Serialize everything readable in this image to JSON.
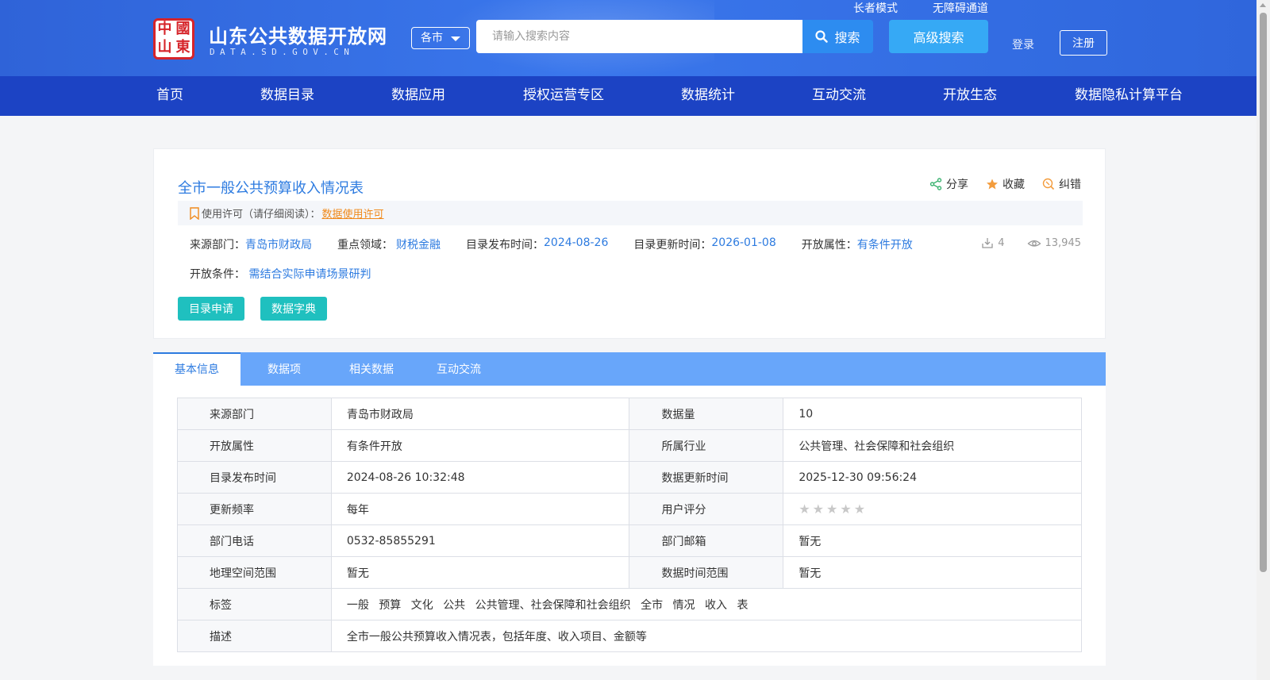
{
  "header": {
    "logo_seal": [
      "中",
      "國",
      "山",
      "東"
    ],
    "site_title": "山东公共数据开放网",
    "site_domain": "DATA.SD.GOV.CN",
    "region_label": "各市",
    "search_placeholder": "请输入搜索内容",
    "search_label": "搜索",
    "advanced_search_label": "高级搜索",
    "elder_mode_label": "长者模式",
    "accessibility_label": "无障碍通道",
    "login_label": "登录",
    "register_label": "注册"
  },
  "nav": {
    "items": [
      "首页",
      "数据目录",
      "数据应用",
      "授权运营专区",
      "数据统计",
      "互动交流",
      "开放生态",
      "数据隐私计算平台"
    ]
  },
  "dataset": {
    "title": "全市一般公共预算收入情况表",
    "actions": {
      "share": "分享",
      "favorite": "收藏",
      "report": "纠错"
    },
    "license_prefix": "使用许可（请仔细阅读）：",
    "license_link": "数据使用许可",
    "meta": {
      "source_label": "来源部门：",
      "source_value": "青岛市财政局",
      "domain_label": "重点领域：",
      "domain_value": "财税金融",
      "published_label": "目录发布时间：",
      "published_value": "2024-08-26",
      "updated_label": "目录更新时间：",
      "updated_value": "2026-01-08",
      "open_attr_label": "开放属性：",
      "open_attr_value": "有条件开放",
      "condition_label": "开放条件：",
      "condition_value": "需结合实际申请场景研判"
    },
    "downloads": "4",
    "views": "13,945",
    "apply_button": "目录申请",
    "dictionary_button": "数据字典"
  },
  "tabs": [
    "基本信息",
    "数据项",
    "相关数据",
    "互动交流"
  ],
  "info_table": {
    "rows": [
      {
        "l1": "来源部门",
        "v1": "青岛市财政局",
        "l2": "数据量",
        "v2": "10"
      },
      {
        "l1": "开放属性",
        "v1": "有条件开放",
        "l2": "所属行业",
        "v2": "公共管理、社会保障和社会组织"
      },
      {
        "l1": "目录发布时间",
        "v1": "2024-08-26 10:32:48",
        "l2": "数据更新时间",
        "v2": "2025-12-30 09:56:24"
      },
      {
        "l1": "更新频率",
        "v1": "每年",
        "l2": "用户评分",
        "v2": ""
      },
      {
        "l1": "部门电话",
        "v1": "0532-85855291",
        "l2": "部门邮箱",
        "v2": "暂无"
      },
      {
        "l1": "地理空间范围",
        "v1": "暂无",
        "l2": "数据时间范围",
        "v2": "暂无"
      }
    ],
    "tags_label": "标签",
    "tags": [
      "一般",
      "预算",
      "文化",
      "公共",
      "公共管理、社会保障和社会组织",
      "全市",
      "情况",
      "收入",
      "表"
    ],
    "desc_label": "描述",
    "desc_value": "全市一般公共预算收入情况表，包括年度、收入项目、金额等",
    "rating": 0,
    "rating_max": 5
  },
  "colors": {
    "header_blue": "#3a77ec",
    "nav_blue": "#1c43c4",
    "link_blue": "#2d7be0",
    "teal": "#1fc0bf",
    "orange": "#f08a1c"
  }
}
